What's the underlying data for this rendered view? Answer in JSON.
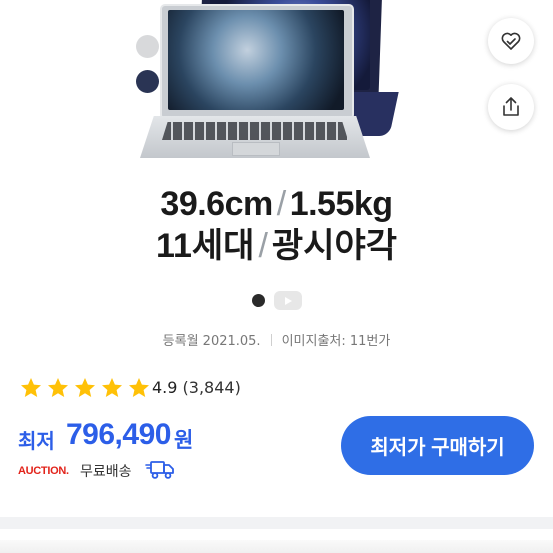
{
  "product": {
    "spec_line1_a": "39.6cm",
    "spec_line1_b": "1.55kg",
    "spec_line2_a": "11세대",
    "spec_line2_b": "광시야각",
    "separator": "/"
  },
  "colors_options": [
    "silver",
    "navy"
  ],
  "meta": {
    "registered": "등록월 2021.05.",
    "image_source": "이미지출처: 11번가"
  },
  "rating": {
    "stars": 5,
    "score": "4.9",
    "count": "(3,844)"
  },
  "price": {
    "label": "최저",
    "value": "796,490",
    "unit": "원"
  },
  "shipping": {
    "seller": "AUCTION.",
    "text": "무료배송"
  },
  "buy_button": "최저가 구매하기",
  "icons": {
    "wish": "heart-check-icon",
    "share": "share-icon",
    "video": "play-icon",
    "truck": "free-delivery-truck-icon"
  },
  "theme": {
    "accent": "#2f6ee6",
    "price_color": "#2c5ee8",
    "star_color": "#ffc107",
    "auction_red": "#e2231a"
  }
}
